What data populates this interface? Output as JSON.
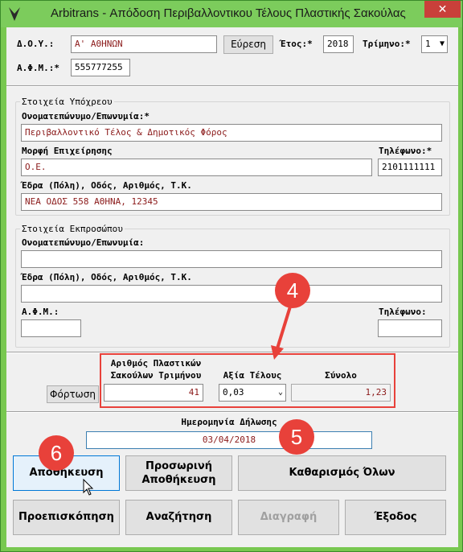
{
  "window": {
    "title": "Arbitrans - Απόδοση Περιβαλλοντικου Τέλους Πλαστικής Σακούλας",
    "close_symbol": "✕",
    "app_icon": "app-logo-icon"
  },
  "header": {
    "doy_label": "Δ.Ο.Υ.:",
    "doy_value": "Α' ΑΘΗΝΩΝ",
    "search_button": "Εύρεση",
    "year_label": "Έτος:*",
    "year_value": "2018",
    "quarter_label": "Τρίμηνο:*",
    "quarter_value": "1",
    "afm_label": "Α.Φ.Μ.:*",
    "afm_value": "555777255"
  },
  "obligor": {
    "title": "Στοιχεία Υπόχρεου",
    "name_label": "Ονοματεπώνυμο/Επωνυμία:*",
    "name_value": "Περιβαλλοντικό Τέλος & Δημοτικός Φόρος",
    "form_label": "Μορφή Επιχείρησης",
    "form_value": "Ο.Ε.",
    "phone_label": "Τηλέφωνο:*",
    "phone_value": "2101111111",
    "address_label": "Έδρα (Πόλη), Οδός, Αριθμός, Τ.Κ.",
    "address_value": "ΝΕΑ ΟΔΟΣ 558 ΑΘΗΝΑ, 12345"
  },
  "representative": {
    "title": "Στοιχεία Εκπροσώπου",
    "name_label": "Ονοματεπώνυμο/Επωνυμία:",
    "name_value": "",
    "address_label": "Έδρα (Πόλη), Οδός, Αριθμός, Τ.Κ.",
    "address_value": "",
    "afm_label": "Α.Φ.Μ.:",
    "afm_value": "",
    "phone_label": "Τηλέφωνο:",
    "phone_value": ""
  },
  "calc": {
    "load_button": "Φόρτωση",
    "bags_label_1": "Αριθμός Πλαστικών",
    "bags_label_2": "Σακούλων Τριμήνου",
    "bags_value": "41",
    "fee_label": "Αξία Τέλους",
    "fee_value": "0,03",
    "total_label": "Σύνολο",
    "total_value": "1,23"
  },
  "declaration": {
    "date_label": "Ημερομηνία Δήλωσης",
    "date_value": "03/04/2018"
  },
  "actions": {
    "save": "Αποθήκευση",
    "temp_save_1": "Προσωρινή",
    "temp_save_2": "Αποθήκευση",
    "clear_all": "Καθαρισμός Όλων",
    "preview": "Προεπισκόπηση",
    "search": "Αναζήτηση",
    "delete": "Διαγραφή",
    "exit": "Έξοδος"
  },
  "annotations": {
    "step4": "4",
    "step5": "5",
    "step6": "6",
    "color": "#e8413a"
  }
}
